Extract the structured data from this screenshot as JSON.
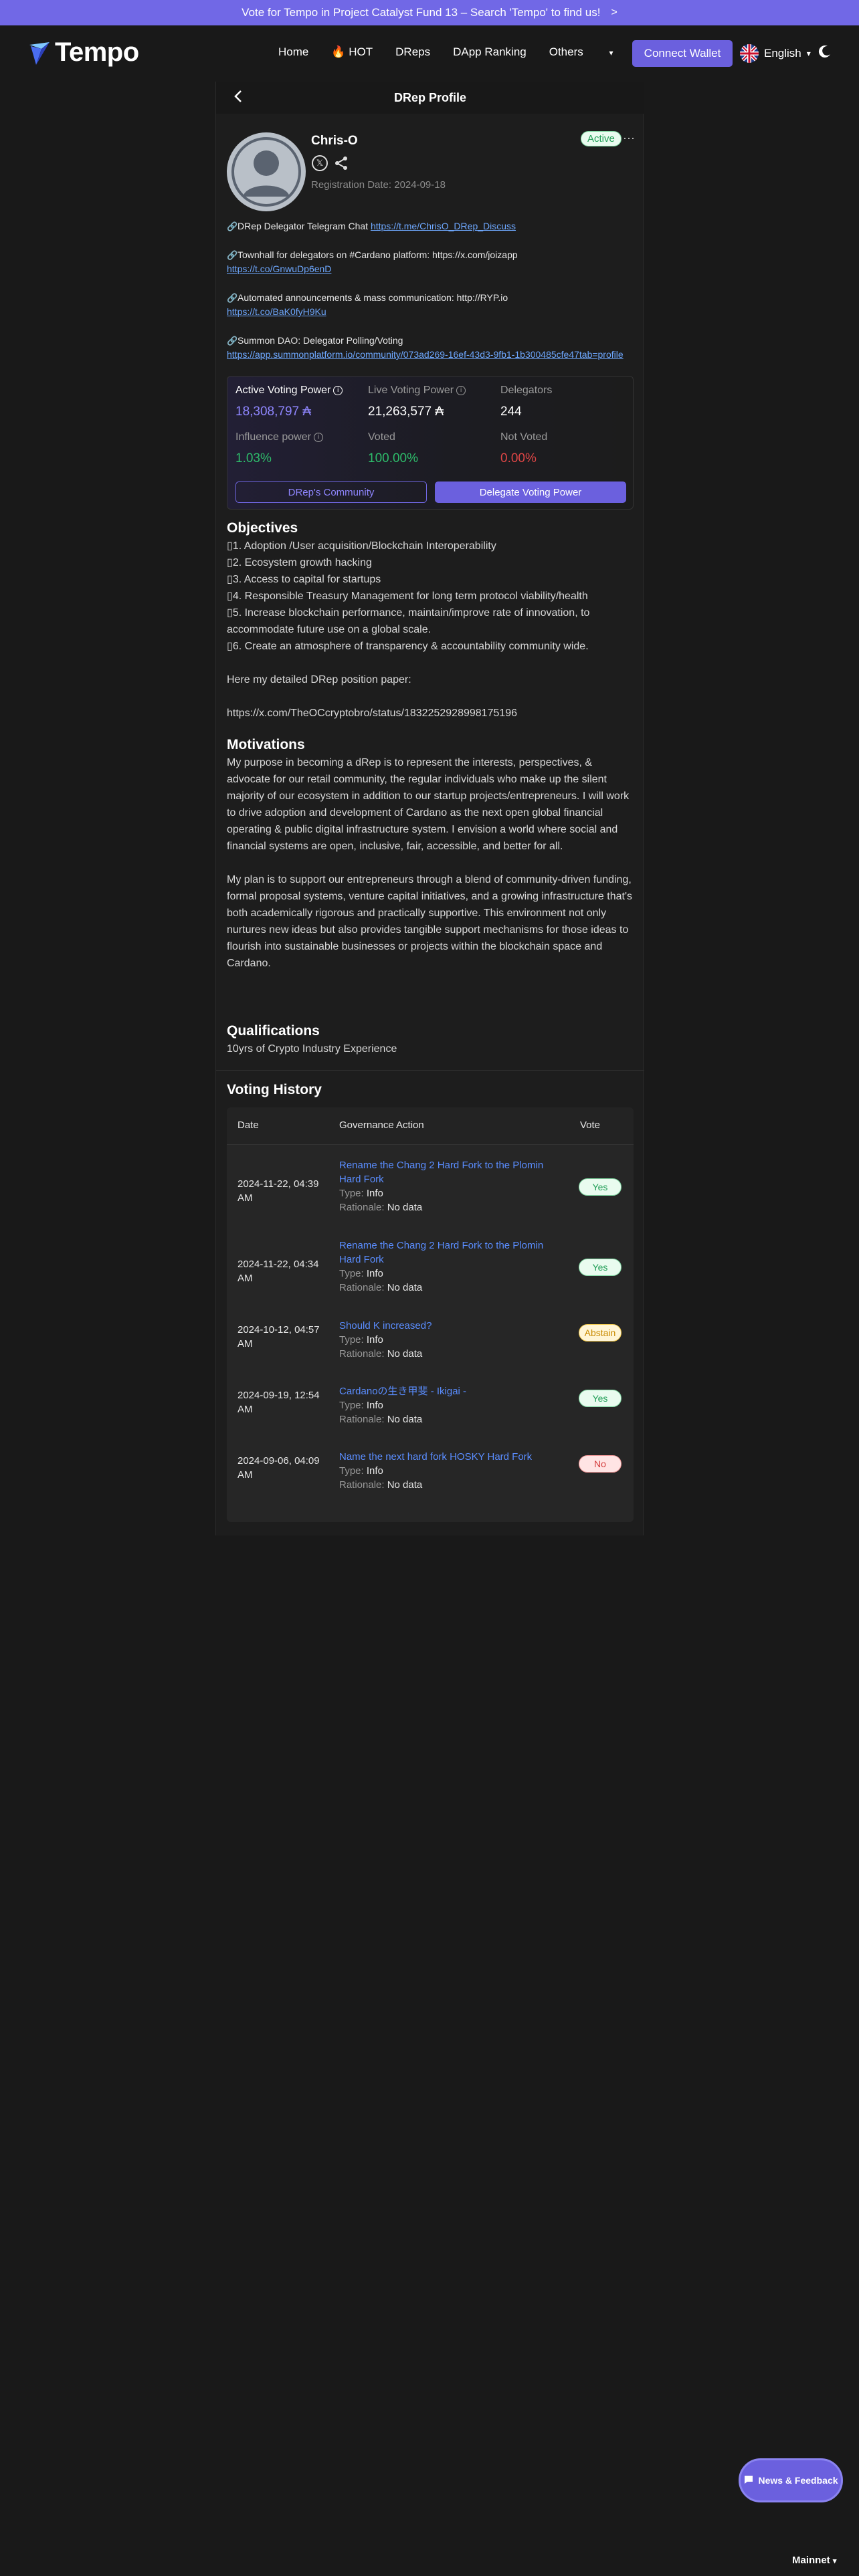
{
  "banner": {
    "text": "Vote for Tempo in Project Catalyst Fund 13 – Search 'Tempo' to find us!",
    "chevron": ">"
  },
  "nav": {
    "logo": "Tempo",
    "items": [
      "Home",
      "🔥 HOT",
      "DReps",
      "DApp Ranking",
      "Others"
    ],
    "others_caret": "▾",
    "connect_label": "Connect Wallet",
    "language": "English",
    "language_caret": "▾"
  },
  "profile": {
    "header_title": "DRep Profile",
    "back_icon": "chevron-left-icon",
    "name": "Chris-O",
    "registration": "Registration Date: 2024-09-18",
    "status": "Active",
    "more": "···",
    "links": [
      {
        "text": "DRep Delegator Telegram Chat ",
        "url": "https://t.me/ChrisO_DRep_Discuss"
      },
      {
        "text": "Townhall for delegators on #Cardano platform: https://x.com/joizapp",
        "url": "https://t.co/GnwuDp6enD"
      },
      {
        "text": "Automated announcements & mass communication: http://RYP.io",
        "url": "https://t.co/BaK0fyH9Ku"
      },
      {
        "text": "Summon DAO: Delegator Polling/Voting",
        "url": "https://app.summonplatform.io/community/073ad269-16ef-43d3-9fb1-1b300485cfe47tab=profile"
      }
    ]
  },
  "stats": {
    "active_voting_power_label": "Active Voting Power",
    "active_voting_power": "18,308,797 ₳",
    "live_voting_power_label": "Live Voting Power",
    "live_voting_power": "21,263,577 ₳",
    "delegators_label": "Delegators",
    "delegators": "244",
    "influence_label": "Influence power",
    "influence": "1.03%",
    "voted_label": "Voted",
    "voted": "100.00%",
    "not_voted_label": "Not Voted",
    "not_voted": "0.00%",
    "community_button": "DRep's Community",
    "delegate_button": "Delegate Voting Power"
  },
  "objectives": {
    "title": "Objectives",
    "items": [
      "1. Adoption /User acquisition/Blockchain Interoperability",
      "2. Ecosystem growth hacking",
      "3. Access to capital for startups",
      "4. Responsible Treasury Management for long term protocol viability/health",
      "5. Increase blockchain performance, maintain/improve rate of innovation, to accommodate future use on a global scale.",
      "6. Create an atmosphere of transparency & accountability community wide."
    ],
    "paper_intro": "Here my detailed DRep position paper:",
    "paper_url": "https://x.com/TheOCcryptobro/status/1832252928998175196"
  },
  "motivations": {
    "title": "Motivations",
    "p1": "My purpose in becoming a dRep is to represent the interests, perspectives, & advocate for our retail community, the regular individuals who make up the silent majority of our ecosystem in addition to our startup projects/entrepreneurs. I will work to drive adoption and development of Cardano as the next open global financial operating & public digital infrastructure system. I envision a world where social and financial systems are open, inclusive, fair, accessible, and better for all.",
    "p2": "My plan is to support our entrepreneurs through a blend of community-driven funding, formal proposal systems, venture capital initiatives, and a growing infrastructure that's both academically rigorous and practically supportive. This environment not only nurtures new ideas but also provides tangible support mechanisms for those ideas to flourish into sustainable businesses or projects within the blockchain space and Cardano."
  },
  "qualifications": {
    "title": "Qualifications",
    "text": "10yrs of Crypto Industry Experience"
  },
  "voting_history": {
    "title": "Voting History",
    "headers": [
      "Date",
      "Governance Action",
      "Vote"
    ],
    "type_label": "Type: ",
    "rationale_label": "Rationale: ",
    "rows": [
      {
        "date": "2024-11-22, 04:39 AM",
        "action": "Rename the Chang 2 Hard Fork to the Plomin Hard Fork",
        "type": "Info",
        "rationale": "No data",
        "vote": "Yes"
      },
      {
        "date": "2024-11-22, 04:34 AM",
        "action": "Rename the Chang 2 Hard Fork to the Plomin Hard Fork",
        "type": "Info",
        "rationale": "No data",
        "vote": "Yes"
      },
      {
        "date": "2024-10-12, 04:57 AM",
        "action": "Should K increased?",
        "type": "Info",
        "rationale": "No data",
        "vote": "Abstain"
      },
      {
        "date": "2024-09-19, 12:54 AM",
        "action": "Cardanoの生き甲斐 - Ikigai -",
        "type": "Info",
        "rationale": "No data",
        "vote": "Yes"
      },
      {
        "date": "2024-09-06, 04:09 AM",
        "action": "Name the next hard fork HOSKY Hard Fork",
        "type": "Info",
        "rationale": "No data",
        "vote": "No"
      }
    ]
  },
  "footer": {
    "feedback": "News & Feedback",
    "network": "Mainnet",
    "network_caret": "▾"
  },
  "colors": {
    "accent": "#6b60de",
    "yes": "#1f9d55",
    "abstain": "#c98a00",
    "no": "#d43c3c",
    "link": "#5a8dff"
  }
}
